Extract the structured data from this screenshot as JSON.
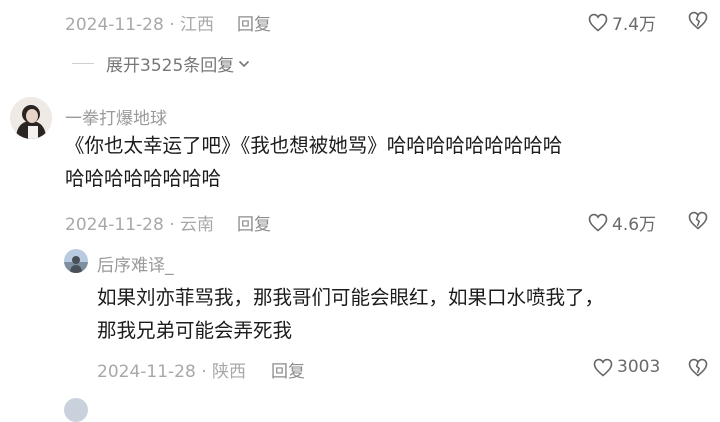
{
  "top_comment": {
    "date": "2024-11-28",
    "location": "江西",
    "reply_label": "回复",
    "likes": "7.4万",
    "expand_label": "展开3525条回复"
  },
  "comment": {
    "username": "一拳打爆地球",
    "text_line1": "《你也太幸运了吧》《我也想被她骂》哈哈哈哈哈哈哈哈哈",
    "text_line2": "哈哈哈哈哈哈哈哈",
    "date": "2024-11-28",
    "location": "云南",
    "reply_label": "回复",
    "likes": "4.6万"
  },
  "reply": {
    "username": "后序难译_",
    "text_line1": "如果刘亦菲骂我，那我哥们可能会眼红，如果口水喷我了，",
    "text_line2": "那我兄弟可能会弄死我",
    "date": "2024-11-28",
    "location": "陕西",
    "reply_label": "回复",
    "likes": "3003"
  },
  "separator": "·",
  "icons": {
    "like": "heart-icon",
    "dislike": "broken-heart-icon",
    "expand": "chevron-down-icon"
  },
  "colors": {
    "text": "#1c1c1c",
    "meta": "#a8a8a8",
    "username": "#9a9a9a"
  }
}
